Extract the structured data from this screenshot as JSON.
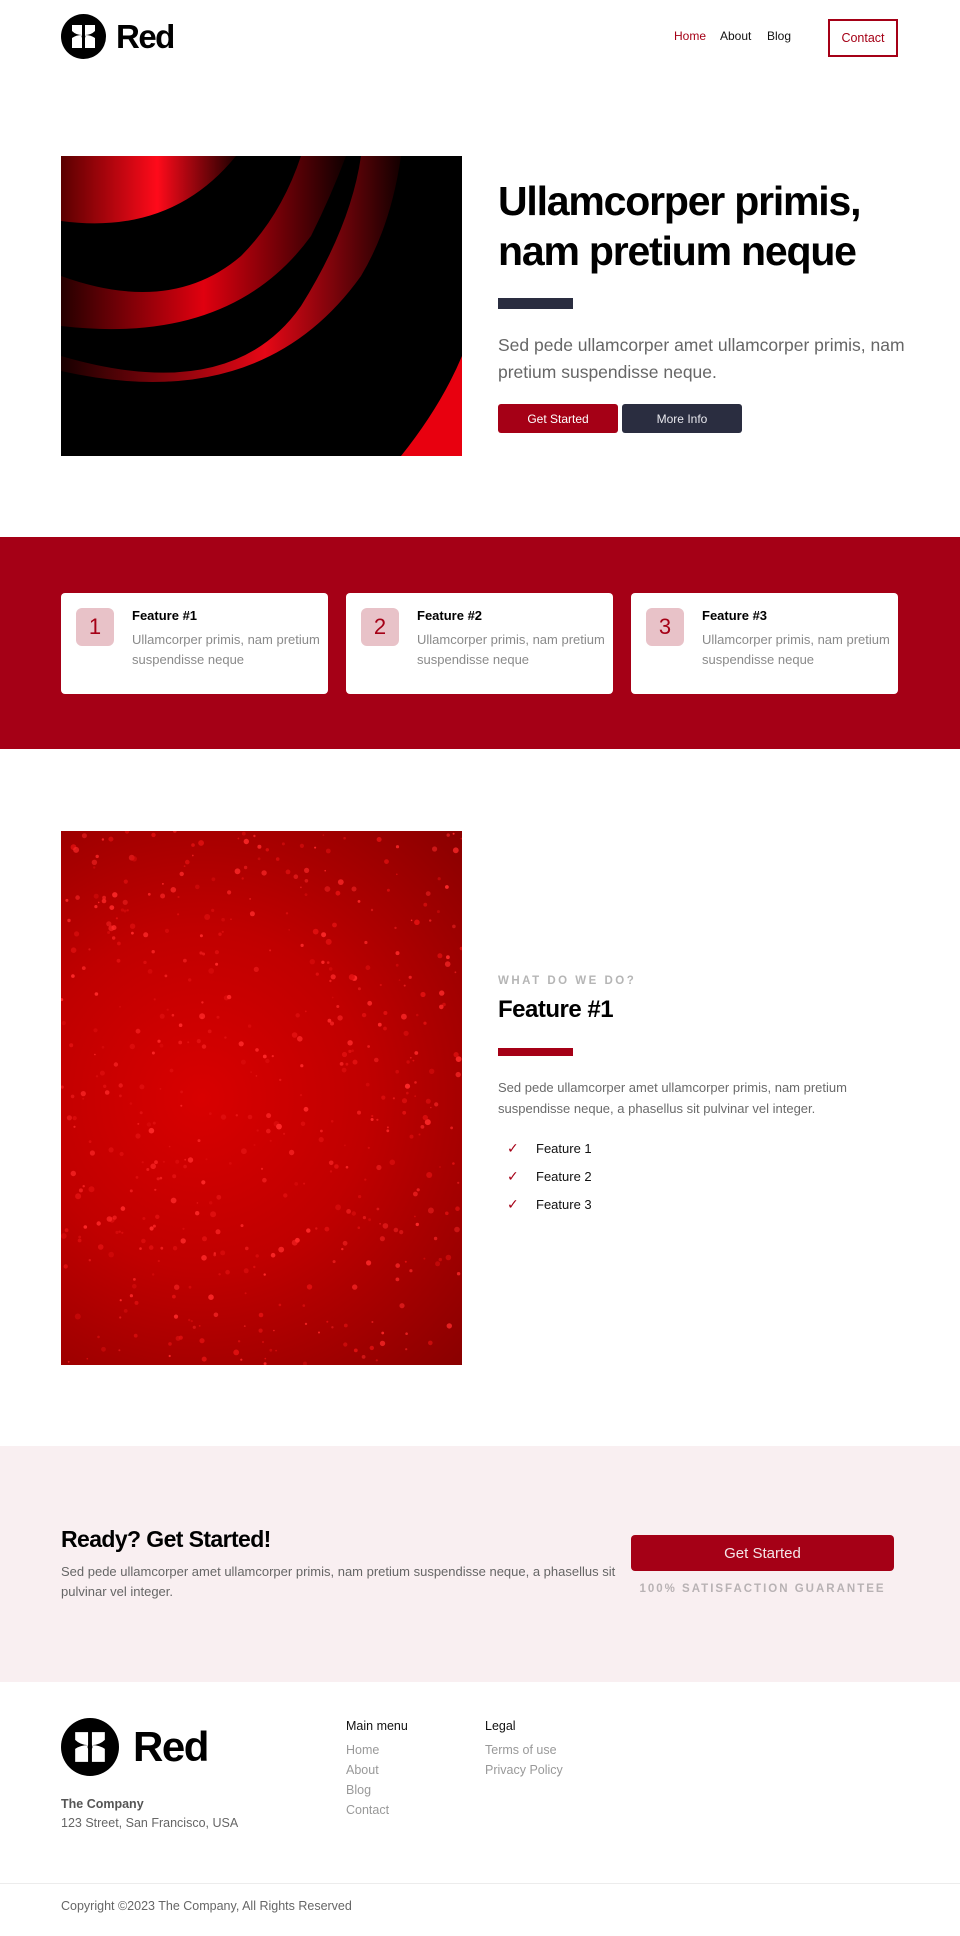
{
  "colors": {
    "brand_red": "#a50016",
    "navy": "#2a2d40",
    "card_badge_bg": "#e8c2c8",
    "cta_bg": "#f9eff1"
  },
  "header": {
    "logo_icon": "flower-logo-icon",
    "logo_text": "Red",
    "nav": [
      {
        "label": "Home",
        "active": true
      },
      {
        "label": "About",
        "active": false
      },
      {
        "label": "Blog",
        "active": false
      }
    ],
    "contact_label": "Contact"
  },
  "hero": {
    "image_desc": "abstract red and black curved layers",
    "title": "Ullamcorper primis, nam pretium neque",
    "subtitle": "Sed pede ullamcorper amet ullamcorper primis, nam pretium suspendisse neque.",
    "primary_button": "Get Started",
    "secondary_button": "More Info"
  },
  "features": [
    {
      "number": "1",
      "title": "Feature #1",
      "text": "Ullamcorper primis, nam pretium suspendisse neque"
    },
    {
      "number": "2",
      "title": "Feature #2",
      "text": "Ullamcorper primis, nam pretium suspendisse neque"
    },
    {
      "number": "3",
      "title": "Feature #3",
      "text": "Ullamcorper primis, nam pretium suspendisse neque"
    }
  ],
  "detail": {
    "image_desc": "red surface with water droplets",
    "eyebrow": "WHAT DO WE DO?",
    "title": "Feature #1",
    "text": "Sed pede ullamcorper amet ullamcorper primis, nam pretium suspendisse neque, a phasellus sit pulvinar vel integer.",
    "checklist_icon": "check-icon",
    "checklist": [
      "Feature 1",
      "Feature 2",
      "Feature 3"
    ]
  },
  "cta": {
    "title": "Ready? Get Started!",
    "text": "Sed pede ullamcorper amet ullamcorper primis, nam pretium suspendisse neque, a phasellus sit pulvinar vel integer.",
    "button": "Get Started",
    "guarantee": "100% SATISFACTION GUARANTEE"
  },
  "footer": {
    "logo_text": "Red",
    "company_name": "The Company",
    "company_address": "123 Street, San Francisco, USA",
    "columns": [
      {
        "heading": "Main menu",
        "links": [
          "Home",
          "About",
          "Blog",
          "Contact"
        ]
      },
      {
        "heading": "Legal",
        "links": [
          "Terms of use",
          "Privacy Policy"
        ]
      }
    ],
    "copyright": "Copyright ©2023 The Company, All Rights Reserved"
  }
}
